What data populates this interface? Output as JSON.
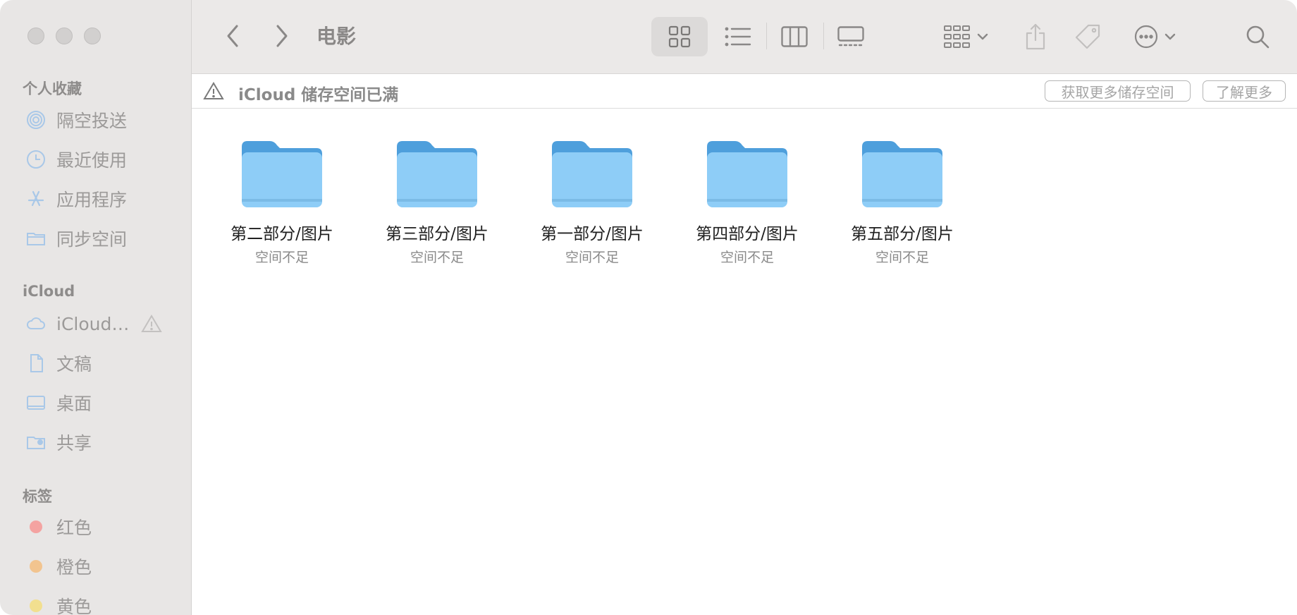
{
  "toolbar": {
    "title": "电影"
  },
  "sidebar": {
    "favorites_title": "个人收藏",
    "favorites": [
      {
        "label": "隔空投送",
        "icon": "airdrop-icon"
      },
      {
        "label": "最近使用",
        "icon": "clock-icon"
      },
      {
        "label": "应用程序",
        "icon": "apps-icon"
      },
      {
        "label": "同步空间",
        "icon": "folder-icon"
      }
    ],
    "icloud_title": "iCloud",
    "icloud": [
      {
        "label": "iCloud…",
        "icon": "cloud-icon"
      },
      {
        "label": "文稿",
        "icon": "document-icon"
      },
      {
        "label": "桌面",
        "icon": "desktop-icon"
      },
      {
        "label": "共享",
        "icon": "shared-folder-icon"
      }
    ],
    "tags_title": "标签",
    "tags": [
      {
        "label": "红色",
        "color": "#f4a3a1"
      },
      {
        "label": "橙色",
        "color": "#f2c48f"
      },
      {
        "label": "黄色",
        "color": "#f2df8f"
      }
    ]
  },
  "banner": {
    "title": "iCloud 储存空间已满",
    "get_more": "获取更多储存空间",
    "learn_more": "了解更多"
  },
  "folders": [
    {
      "name": "第二部分/图片",
      "status": "空间不足"
    },
    {
      "name": "第三部分/图片",
      "status": "空间不足"
    },
    {
      "name": "第一部分/图片",
      "status": "空间不足"
    },
    {
      "name": "第四部分/图片",
      "status": "空间不足"
    },
    {
      "name": "第五部分/图片",
      "status": "空间不足"
    }
  ],
  "colors": {
    "folder_light": "#8ecdf7",
    "folder_dark": "#4e9fdc",
    "accent_icon": "#a9c8e8"
  }
}
